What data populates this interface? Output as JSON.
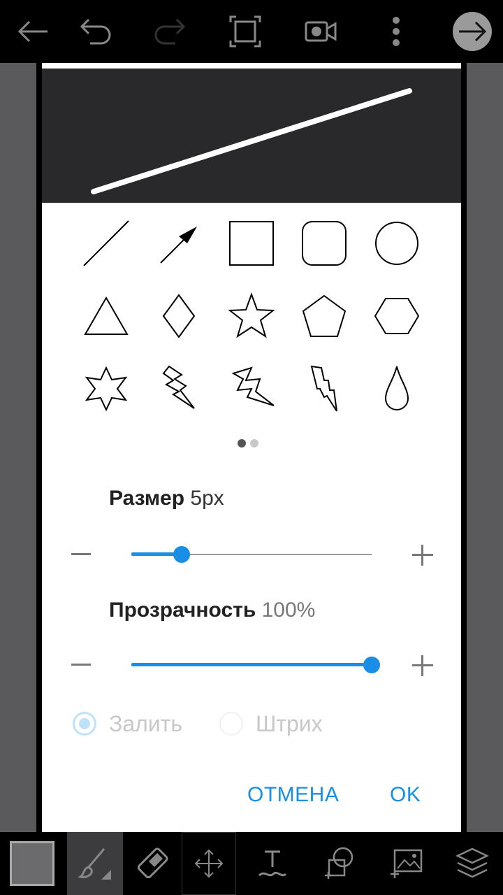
{
  "toolbar": {
    "back_icon": "arrow-left-icon",
    "undo_icon": "undo-icon",
    "redo_icon": "redo-icon",
    "crop_icon": "crop-frame-icon",
    "record_icon": "video-camera-icon",
    "more_icon": "more-vertical-icon",
    "next_icon": "arrow-right-circle-icon"
  },
  "shapes": {
    "items": [
      "line",
      "arrow",
      "square",
      "rounded-square",
      "circle",
      "triangle",
      "diamond",
      "star",
      "pentagon",
      "hexagon",
      "six-point-star",
      "lightning-1",
      "lightning-2",
      "lightning-3",
      "drop"
    ],
    "page_index": 1,
    "page_count": 2
  },
  "size": {
    "label": "Размер",
    "value": "5px",
    "fraction": 0.21
  },
  "opacity": {
    "label": "Прозрачность",
    "value": "100%",
    "fraction": 1.0
  },
  "fill_options": {
    "fill_label": "Залить",
    "stroke_label": "Штрих",
    "selected": "fill"
  },
  "buttons": {
    "cancel": "ОТМЕНА",
    "ok": "OK"
  },
  "bottom": {
    "tools": [
      "color-swatch",
      "brush-icon",
      "eraser-icon",
      "move-icon",
      "text-icon",
      "shape-add-icon",
      "image-add-icon",
      "layers-icon"
    ]
  },
  "colors": {
    "accent": "#1a8ee6",
    "preview_bg": "#29282a",
    "swatch": "#6b6b6d"
  }
}
